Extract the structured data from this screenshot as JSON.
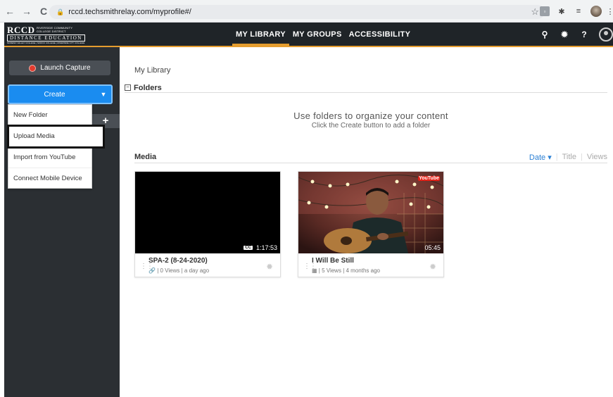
{
  "browser": {
    "url": "rccd.techsmithrelay.com/myprofile#/"
  },
  "logo": {
    "name": "RCCD",
    "district": "RIVERSIDE COMMUNITY COLLEGE DISTRICT",
    "dept": "DISTANCE EDUCATION",
    "colleges": "MORENO VALLEY COLLEGE | NORCO COLLEGE | RIVERSIDE CITY COLLEGE"
  },
  "nav": {
    "tabs": [
      "MY LIBRARY",
      "MY GROUPS",
      "ACCESSIBILITY"
    ]
  },
  "sidebar": {
    "capture_label": "Launch Capture",
    "create_label": "Create",
    "add_symbol": "+"
  },
  "dropdown": {
    "items": [
      "New Folder",
      "Upload Media",
      "Import from YouTube",
      "Connect Mobile Device"
    ]
  },
  "content": {
    "breadcrumb": "My Library",
    "folders_heading": "Folders",
    "empty_title": "Use folders to organize your content",
    "empty_sub": "Click the Create button to add a folder",
    "media_heading": "Media",
    "sorts": [
      "Date",
      "Title",
      "Views"
    ]
  },
  "media": [
    {
      "title": "SPA-2 (8-24-2020)",
      "duration": "1:17:53",
      "views": "0 Views",
      "age": "a day ago",
      "cc": "CC"
    },
    {
      "title": "I Will Be Still",
      "duration": "05:45",
      "views": "5 Views",
      "age": "4 months ago",
      "badge": "YouTube"
    }
  ],
  "colors": {
    "accent": "#e59d2f",
    "create_blue": "#1a8cf0",
    "header_bg": "#1f2428",
    "sidebar_bg": "#2b2f33"
  }
}
